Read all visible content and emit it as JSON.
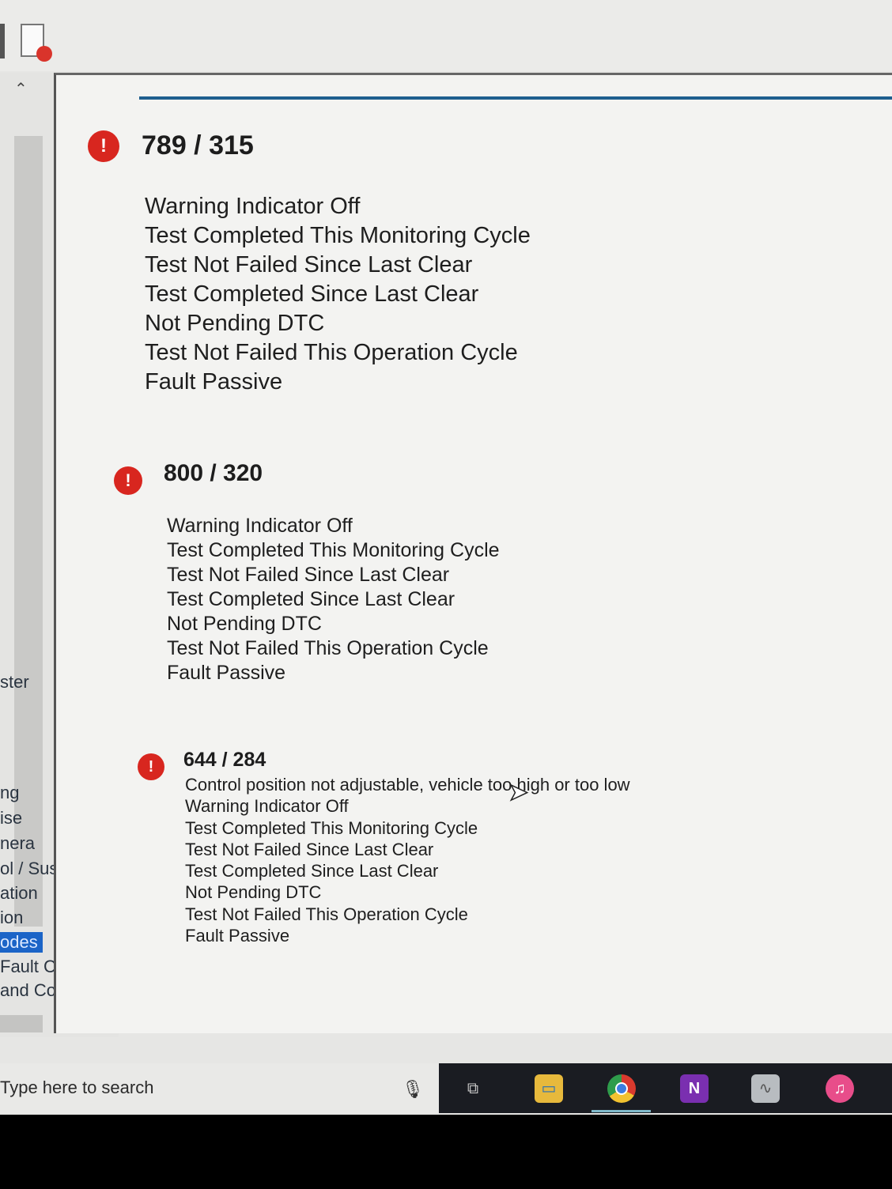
{
  "sidebar": {
    "items": [
      "ster",
      "ng",
      "ise",
      "nera",
      "ol / Suspe",
      "ation",
      "ion",
      "odes",
      "Fault Codes",
      "and Consol"
    ],
    "selected": "odes"
  },
  "faults": [
    {
      "code": "789 / 315",
      "lines": [
        "Warning Indicator Off",
        "Test Completed This Monitoring Cycle",
        "Test Not Failed Since Last Clear",
        "Test Completed Since Last Clear",
        "Not Pending DTC",
        "Test Not Failed This Operation Cycle",
        "Fault Passive"
      ]
    },
    {
      "code": "800 / 320",
      "lines": [
        "Warning Indicator Off",
        "Test Completed This Monitoring Cycle",
        "Test Not Failed Since Last Clear",
        "Test Completed Since Last Clear",
        "Not Pending DTC",
        "Test Not Failed This Operation Cycle",
        "Fault Passive"
      ]
    },
    {
      "code": "644 / 284",
      "lines": [
        "Control position not adjustable, vehicle too high or too low",
        "Warning Indicator Off",
        "Test Completed This Monitoring Cycle",
        "Test Not Failed Since Last Clear",
        "Test Completed Since Last Clear",
        "Not Pending DTC",
        "Test Not Failed This Operation Cycle",
        "Fault Passive"
      ]
    }
  ],
  "icons": {
    "fault": "error-exclamation-icon",
    "fault_color": "#d8261f"
  },
  "taskbar": {
    "search_placeholder": "Type here to search",
    "apps": [
      "task-view",
      "file-explorer",
      "chrome",
      "onenote",
      "system-monitor",
      "itunes"
    ],
    "active": "chrome"
  }
}
